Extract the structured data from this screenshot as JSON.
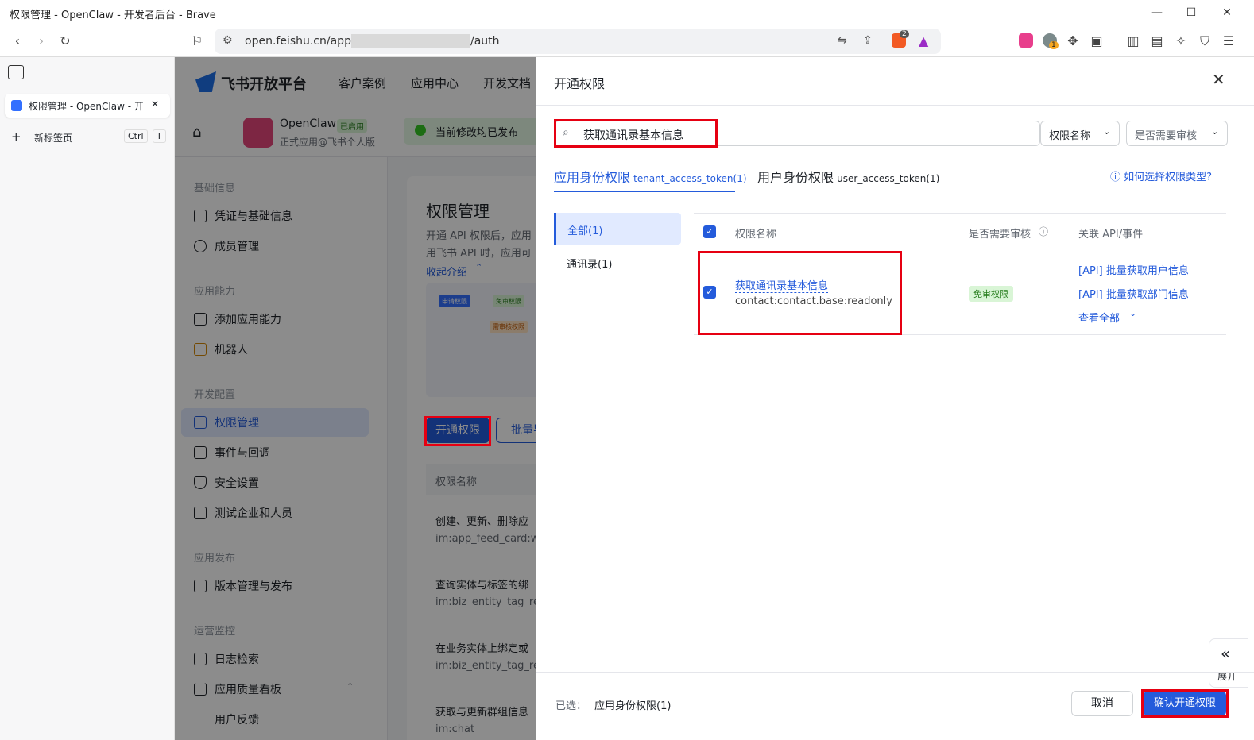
{
  "window": {
    "title": "权限管理 - OpenClaw - 开发者后台 - Brave"
  },
  "browser": {
    "url_prefix": "open.feishu.cn/app/",
    "url_suffix": "/auth",
    "brave_badge": "2",
    "ext_badge": "1",
    "tabs": [
      {
        "label": "权限管理 - OpenClaw - 开"
      }
    ],
    "new_tab": {
      "label": "新标签页",
      "key1": "Ctrl",
      "key2": "T"
    }
  },
  "header": {
    "logo": "飞书开放平台",
    "nav": [
      "客户案例",
      "应用中心",
      "开发文档"
    ]
  },
  "app": {
    "name": "OpenClaw",
    "status": "已启用",
    "subtitle": "正式应用@飞书个人版",
    "publish_state": "当前修改均已发布"
  },
  "leftnav": {
    "sections": [
      {
        "title": "基础信息",
        "items": [
          "凭证与基础信息",
          "成员管理"
        ]
      },
      {
        "title": "应用能力",
        "items": [
          "添加应用能力",
          "机器人"
        ]
      },
      {
        "title": "开发配置",
        "items": [
          "权限管理",
          "事件与回调",
          "安全设置",
          "测试企业和人员"
        ]
      },
      {
        "title": "应用发布",
        "items": [
          "版本管理与发布"
        ]
      },
      {
        "title": "运营监控",
        "items": [
          "日志检索",
          "应用质量看板",
          "用户反馈"
        ]
      }
    ]
  },
  "main": {
    "title": "权限管理",
    "desc1": "开通 API 权限后，应用",
    "desc2": "用飞书 API 时，应用可",
    "collapse": "收起介绍",
    "illus": [
      "申请权限",
      "免审权限",
      "需审核权限"
    ],
    "open_btn": "开通权限",
    "batch_btn": "批量导",
    "col_header": "权限名称",
    "rows": [
      {
        "name": "创建、更新、删除应",
        "code": "im:app_feed_card:w"
      },
      {
        "name": "查询实体与标签的绑",
        "code": "im:biz_entity_tag_re"
      },
      {
        "name": "在业务实体上绑定或",
        "code": "im:biz_entity_tag_re"
      },
      {
        "name": "获取与更新群组信息",
        "code": "im:chat"
      }
    ]
  },
  "drawer": {
    "title": "开通权限",
    "search_value": "获取通讯录基本信息",
    "filter1": "权限名称",
    "filter2": "是否需要审核",
    "tab1_label": "应用身份权限",
    "tab1_token": "tenant_access_token(1)",
    "tab2_label": "用户身份权限",
    "tab2_token": "user_access_token(1)",
    "help": "如何选择权限类型?",
    "categories": [
      "全部(1)",
      "通讯录(1)"
    ],
    "columns": {
      "name": "权限名称",
      "review": "是否需要审核",
      "api": "关联 API/事件"
    },
    "row": {
      "name": "获取通讯录基本信息",
      "code": "contact:contact.base:readonly",
      "badge": "免审权限",
      "api1": "[API] 批量获取用户信息",
      "api2": "[API] 批量获取部门信息",
      "view_all": "查看全部"
    },
    "footer": {
      "selected_label": "已选：",
      "selected_value": "应用身份权限(1)",
      "cancel": "取消",
      "confirm": "确认开通权限"
    },
    "expand": "展开"
  },
  "colors": {
    "primary": "#245bdb",
    "red_highlight": "#e60012",
    "green_badge_bg": "#d9f5d6",
    "green_badge_fg": "#237b19"
  }
}
